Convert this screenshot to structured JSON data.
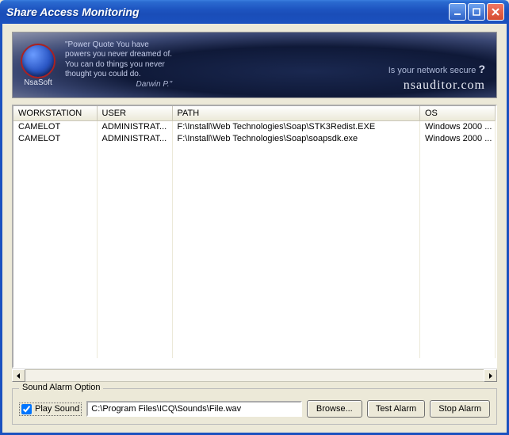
{
  "window": {
    "title": "Share Access Monitoring"
  },
  "banner": {
    "brand": "NsaSoft",
    "quote_line1": "\"Power Quote You have",
    "quote_line2": "powers you never dreamed of.",
    "quote_line3": "You can do things you never",
    "quote_line4": "thought you could do.",
    "quote_author": "Darwin P.\"",
    "tagline_prefix": "Is your network secure",
    "tagline_q": "?",
    "url": "nsauditor.com"
  },
  "columns": {
    "workstation": "WORKSTATION",
    "user": "USER",
    "path": "PATH",
    "os": "OS"
  },
  "rows": [
    {
      "workstation": "CAMELOT",
      "user": "ADMINISTRAT...",
      "path": "F:\\Install\\Web Technologies\\Soap\\STK3Redist.EXE",
      "os": "Windows 2000 ..."
    },
    {
      "workstation": "CAMELOT",
      "user": "ADMINISTRAT...",
      "path": "F:\\Install\\Web Technologies\\Soap\\soapsdk.exe",
      "os": "Windows 2000 ..."
    }
  ],
  "sound_alarm": {
    "legend": "Sound Alarm Option",
    "play_label": "Play Sound",
    "play_checked": true,
    "path": "C:\\Program Files\\ICQ\\Sounds\\File.wav",
    "browse": "Browse...",
    "test": "Test Alarm",
    "stop": "Stop Alarm"
  }
}
